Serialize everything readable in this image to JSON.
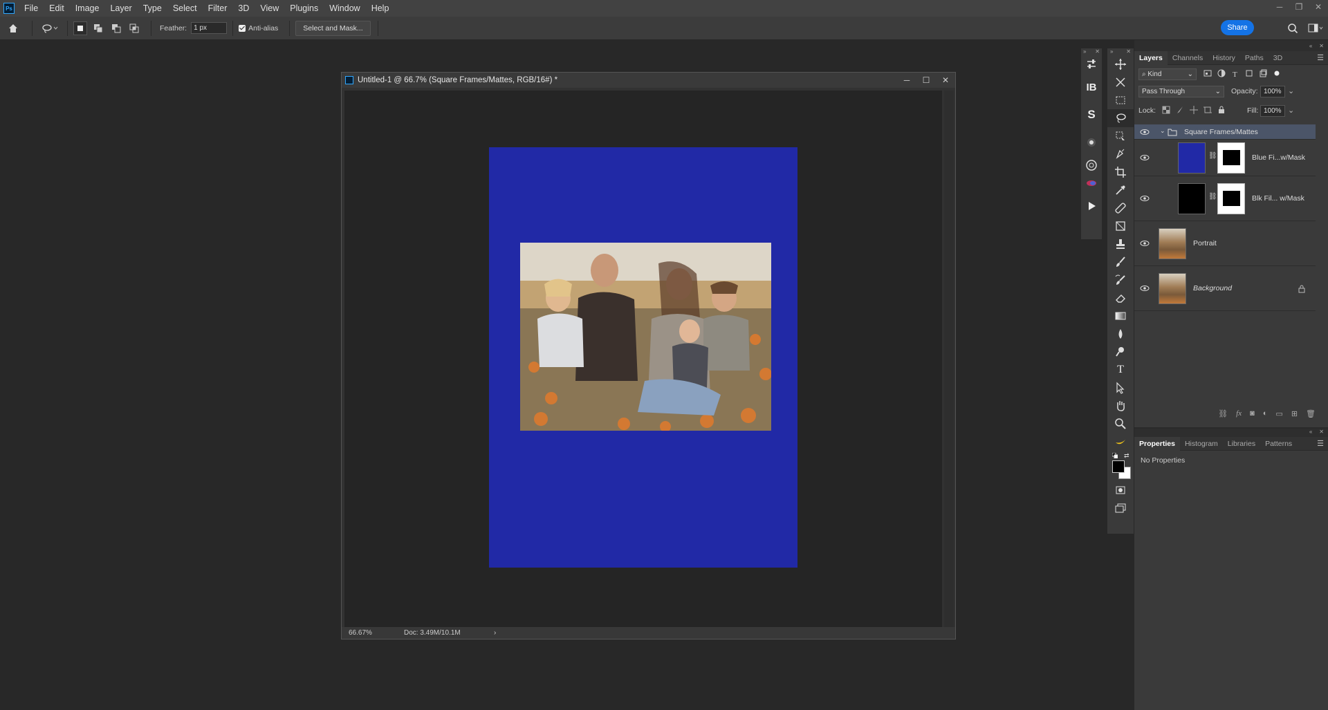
{
  "menu": {
    "items": [
      "File",
      "Edit",
      "Image",
      "Layer",
      "Type",
      "Select",
      "Filter",
      "3D",
      "View",
      "Plugins",
      "Window",
      "Help"
    ]
  },
  "app_icon": "Ps",
  "window_controls": [
    "─",
    "❐",
    "✕"
  ],
  "options": {
    "feather_label": "Feather:",
    "feather_value": "1 px",
    "antialias_label": "Anti-alias",
    "select_mask_label": "Select and Mask...",
    "share_label": "Share"
  },
  "document": {
    "title": "Untitled-1 @ 66.7% (Square Frames/Mattes, RGB/16#) *",
    "zoom": "66.67%",
    "doc_size": "Doc: 3.49M/10.1M",
    "matte_color": "#2129a6"
  },
  "layers_panel": {
    "tabs": [
      "Layers",
      "Channels",
      "History",
      "Paths",
      "3D"
    ],
    "active_tab": "Layers",
    "filter_label": "Kind",
    "blend_mode": "Pass Through",
    "opacity_label": "Opacity:",
    "opacity_value": "100%",
    "lock_label": "Lock:",
    "fill_label": "Fill:",
    "fill_value": "100%",
    "layers": [
      {
        "name": "Square Frames/Mattes",
        "type": "group",
        "selected": true
      },
      {
        "name": "Blue Fi...w/Mask",
        "type": "fill-mask",
        "color": "#2129a6"
      },
      {
        "name": "Blk Fil... w/Mask",
        "type": "fill-mask",
        "color": "#000000"
      },
      {
        "name": "Portrait",
        "type": "image"
      },
      {
        "name": "Background",
        "type": "image",
        "locked": true
      }
    ]
  },
  "properties_panel": {
    "tabs": [
      "Properties",
      "Histogram",
      "Libraries",
      "Patterns"
    ],
    "active_tab": "Properties",
    "content": "No Properties"
  },
  "toolbar_icons": [
    "move-icon",
    "artboard-icon",
    "marquee-icon",
    "lasso-icon",
    "object-select-icon",
    "pen-icon",
    "crop-icon",
    "eyedropper-icon",
    "healing-icon",
    "frame-icon",
    "stamp-icon",
    "brush-icon",
    "history-brush-icon",
    "eraser-icon",
    "gradient-icon",
    "blur-icon",
    "dodge-icon",
    "type-icon",
    "path-select-icon",
    "hand-icon",
    "zoom-icon",
    "banana-icon"
  ],
  "plugin_icons": [
    "IB",
    "S"
  ]
}
